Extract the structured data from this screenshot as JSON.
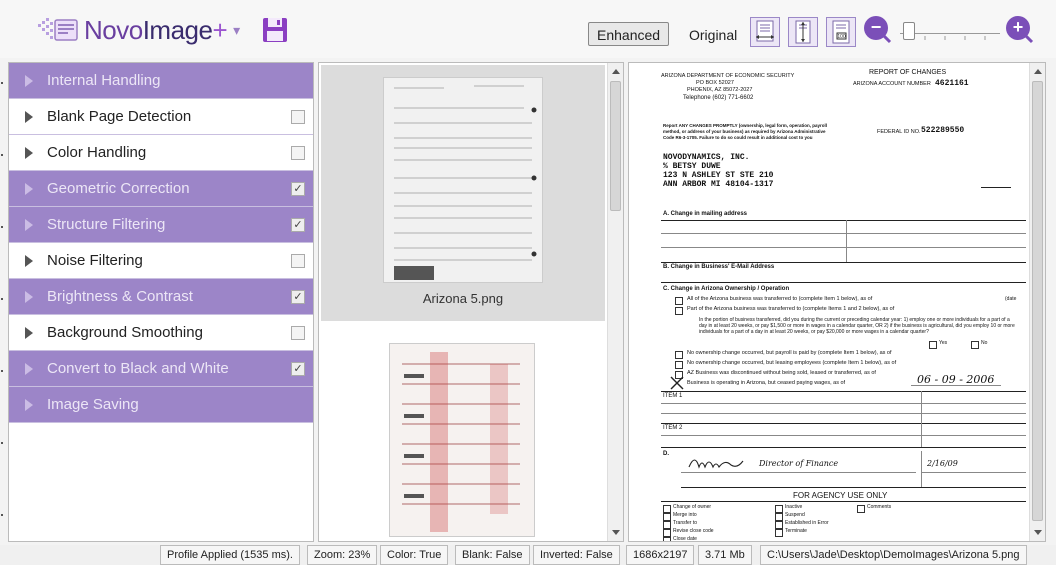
{
  "toolbar": {
    "logo_novo": "Novo",
    "logo_image": "Image",
    "logo_plus": "+",
    "logo_caret": "▾",
    "enhanced_label": "Enhanced",
    "original_label": "Original",
    "zoom_out": "−",
    "zoom_in": "+",
    "zoom_level": 0.08,
    "icons": [
      "app-logo-icon",
      "save-icon",
      "fit-width-icon",
      "fit-height-icon",
      "actual-size-icon",
      "zoom-out-icon",
      "zoom-in-icon"
    ]
  },
  "steps": [
    {
      "label": "Internal Handling",
      "active": true,
      "has_checkbox": false,
      "checked": false
    },
    {
      "label": "Blank Page Detection",
      "active": false,
      "has_checkbox": true,
      "checked": false
    },
    {
      "label": "Color Handling",
      "active": false,
      "has_checkbox": true,
      "checked": false
    },
    {
      "label": "Geometric Correction",
      "active": true,
      "has_checkbox": true,
      "checked": true
    },
    {
      "label": "Structure Filtering",
      "active": true,
      "has_checkbox": true,
      "checked": true
    },
    {
      "label": "Noise Filtering",
      "active": false,
      "has_checkbox": true,
      "checked": false
    },
    {
      "label": "Brightness & Contrast",
      "active": true,
      "has_checkbox": true,
      "checked": true
    },
    {
      "label": "Background Smoothing",
      "active": false,
      "has_checkbox": true,
      "checked": false
    },
    {
      "label": "Convert to Black and White",
      "active": true,
      "has_checkbox": true,
      "checked": true
    },
    {
      "label": "Image Saving",
      "active": true,
      "has_checkbox": false,
      "checked": false
    }
  ],
  "checkmark": "✓",
  "thumbnails": [
    {
      "name": "Arizona 5.png",
      "selected": true
    },
    {
      "name": "",
      "selected": false
    }
  ],
  "document": {
    "dept": "ARIZONA DEPARTMENT OF ECONOMIC SECURITY",
    "po": "PO BOX 52027",
    "city": "PHOENIX, AZ 85072-2027",
    "phone": "Telephone (602) 771-6602",
    "report_title": "REPORT OF CHANGES",
    "account_label": "ARIZONA ACCOUNT NUMBER",
    "account_number": "4621161",
    "instruction": "Report ANY CHANGES PROMPTLY (ownership, legal form, operation, payroll method, or address of your business) as required by Arizona Administrative Code R6-3-1705. Failure to do so could result in additional cost to you",
    "fed_label": "FEDERAL ID NO.",
    "fed_number": "522289550",
    "company": "NOVODYNAMICS, INC.",
    "attn": "% BETSY DUWE",
    "street": "123 N ASHLEY ST STE 210",
    "city2": "ANN ARBOR          MI 48104-1317",
    "sec_a": "A.  Change in mailing address",
    "sec_b": "B.  Change in Business' E-Mail Address",
    "sec_c": "C.  Change in Arizona Ownership / Operation",
    "c_line1": "All of the Arizona business was transferred to (complete Item 1 below), as of",
    "c_line2": "Part of the Arizona business was transferred to (complete Items 1 and 2 below), as of",
    "c_line3": "In the portion of business transferred, did you during the current or preceding calendar year: 1) employ one or more individuals for a part of a day in at least 20 weeks, or pay $1,500 or more in wages in a calendar quarter, OR 2) if the business is agricultural, did you employ 10 or more individuals for a part of a day in at least 20 weeks, or pay $20,000 or more wages in a calendar quarter?",
    "yes": "Yes",
    "no": "No",
    "c_line4": "No ownership change occurred, but payroll is paid by (complete Item 1 below), as of",
    "c_line5": "No ownership change occurred, but leasing employees (complete Item 1 below), as of",
    "c_line6": "AZ Business was discontinued without being sold, leased or transferred, as of",
    "c_line7": "Business is operating in Arizona, but ceased paying wages, as of",
    "handwritten_date": "06 - 09 - 2006",
    "date_label": "(date",
    "item1": "ITEM 1",
    "item2": "ITEM 2",
    "sec_d": "D.",
    "signature_name": "Director of Finance",
    "sig_date": "2/16/09",
    "agency": "FOR AGENCY USE ONLY",
    "agency_left": [
      "Change of owner",
      "Merge into",
      "Transfer to",
      "Revise close code",
      "Close date"
    ],
    "agency_mid": [
      "Inactive",
      "Suspend",
      "Established in Error",
      "Terminate"
    ],
    "agency_right": "Comments"
  },
  "status": {
    "profile": "Profile Applied (1535 ms).",
    "zoom": "Zoom: 23%",
    "color": "Color: True",
    "blank": "Blank: False",
    "inverted": "Inverted: False",
    "dimensions": "1686x2197",
    "size": "3.71 Mb",
    "path": "C:\\Users\\Jade\\Desktop\\DemoImages\\Arizona 5.png"
  },
  "colors": {
    "accent": "#7b4fb8",
    "step_active_bg": "#9c85c8",
    "step_active_text": "#ece6f6"
  }
}
